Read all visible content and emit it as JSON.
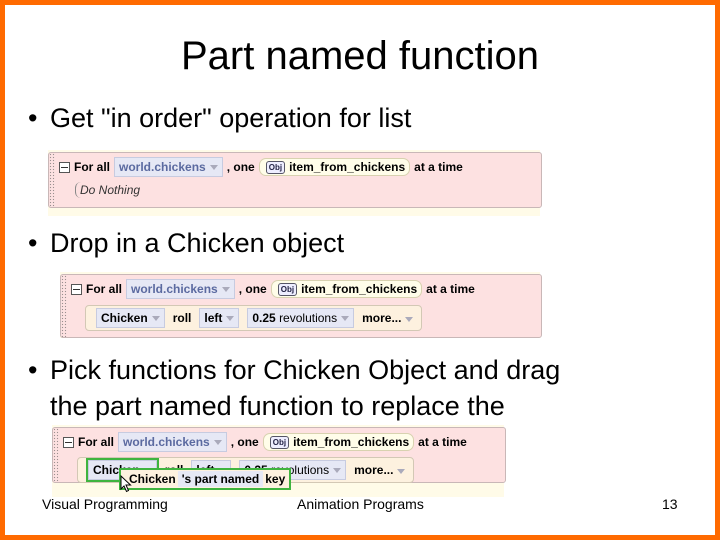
{
  "slide": {
    "title": "Part named function",
    "bullets": [
      {
        "text": "Get \"in order\" operation for list"
      },
      {
        "text": "Drop in a Chicken object"
      },
      {
        "line1": "Pick functions for Chicken Object and drag",
        "line2": "the part named function to replace the"
      }
    ],
    "bullet_char": "•",
    "colors": {
      "frame": "#ff6a00",
      "block_bg": "#fde1e1",
      "highlight": "#3fb43f"
    }
  },
  "block1": {
    "for_all": "For all",
    "list": "world.chickens",
    "one": ", one",
    "obj_badge": "Obj",
    "item": "item_from_chickens",
    "at_a_time": "at a time",
    "body": "Do Nothing"
  },
  "block2": {
    "for_all": "For all",
    "list": "world.chickens",
    "one": ", one",
    "obj_badge": "Obj",
    "item": "item_from_chickens",
    "at_a_time": "at a time",
    "object": "Chicken",
    "method": "roll",
    "direction": "left",
    "amount": "0.25",
    "unit": "revolutions",
    "more": "more..."
  },
  "block3": {
    "for_all": "For all",
    "list": "world.chickens",
    "one": ", one",
    "obj_badge": "Obj",
    "item": "item_from_chickens",
    "at_a_time": "at a time",
    "object": "Chicken",
    "method": "roll",
    "direction": "left",
    "amount": "0.25",
    "unit": "revolutions",
    "more": "more...",
    "drag_object": "Chicken",
    "drag_function": "'s part named",
    "drag_part": "key"
  },
  "footer": {
    "left": "Visual Programming",
    "center": "Animation Programs",
    "page": "13"
  }
}
